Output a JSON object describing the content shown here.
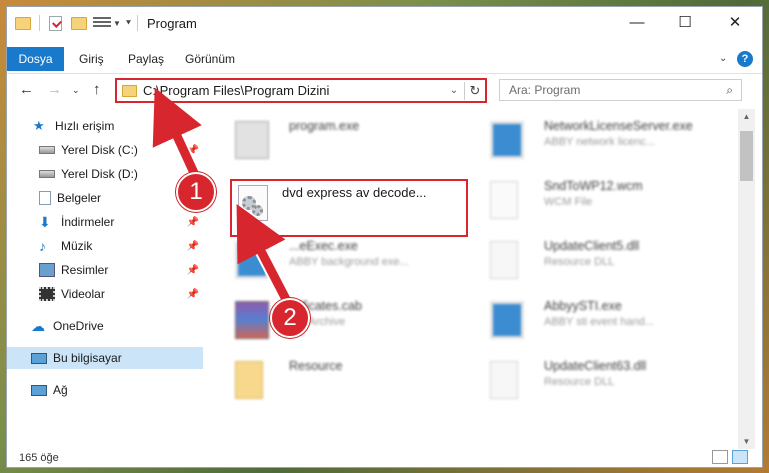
{
  "window": {
    "title": "Program"
  },
  "ribbon": {
    "file": "Dosya",
    "tabs": [
      "Giriş",
      "Paylaş",
      "Görünüm"
    ]
  },
  "address": {
    "path": "C:\\Program Files\\Program Dizini"
  },
  "search": {
    "placeholder": "Ara: Program"
  },
  "sidebar": {
    "items": [
      {
        "label": "Hızlı erişim",
        "icon": "star-icon"
      },
      {
        "label": "Yerel Disk (C:)",
        "icon": "drive-icon"
      },
      {
        "label": "Yerel Disk (D:)",
        "icon": "drive-icon"
      },
      {
        "label": "Belgeler",
        "icon": "documents-icon"
      },
      {
        "label": "İndirmeler",
        "icon": "download-icon"
      },
      {
        "label": "Müzik",
        "icon": "music-icon"
      },
      {
        "label": "Resimler",
        "icon": "pictures-icon"
      },
      {
        "label": "Videolar",
        "icon": "video-icon"
      },
      {
        "label": "OneDrive",
        "icon": "cloud-icon"
      },
      {
        "label": "Bu bilgisayar",
        "icon": "computer-icon"
      },
      {
        "label": "Ağ",
        "icon": "network-icon"
      }
    ]
  },
  "files": [
    {
      "name": "program.exe",
      "sub": ""
    },
    {
      "name": "NetworkLicenseServer.exe",
      "sub": "ABBY network licenc..."
    },
    {
      "name": "dvd express av decode...",
      "sub": ""
    },
    {
      "name": "SndToWP12.wcm",
      "sub": "WCM File"
    },
    {
      "name": "...eExec.exe",
      "sub": "ABBY background exe..."
    },
    {
      "name": "UpdateClient5.dll",
      "sub": "Resource DLL"
    },
    {
      "name": "...ificates.cab",
      "sub": "...R Archive"
    },
    {
      "name": "AbbyySTI.exe",
      "sub": "ABBY sti event hand..."
    },
    {
      "name": "Resource",
      "sub": ""
    },
    {
      "name": "UpdateClient63.dll",
      "sub": "Resource DLL"
    }
  ],
  "status": {
    "count": "165 öğe"
  },
  "annotations": {
    "step1": "1",
    "step2": "2"
  },
  "colors": {
    "accent": "#1979ca",
    "highlight": "#d8262e",
    "selected": "#cce4f7"
  }
}
